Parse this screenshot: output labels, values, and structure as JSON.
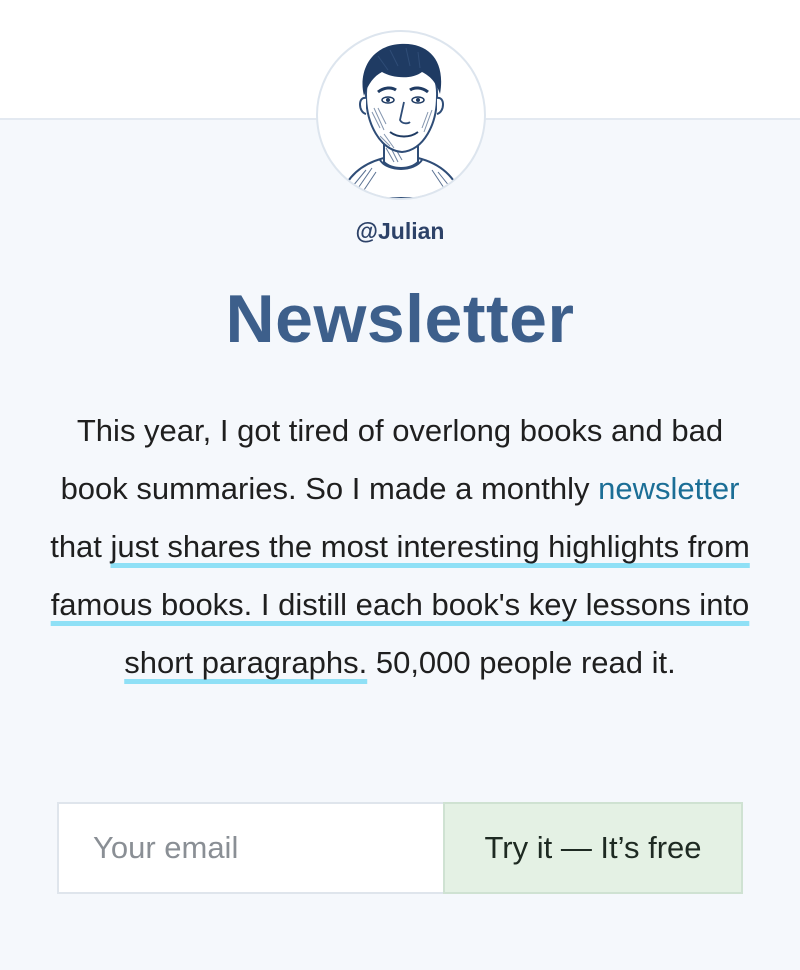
{
  "profile": {
    "username": "@Julian"
  },
  "header": {
    "title": "Newsletter"
  },
  "intro": {
    "part1": "This year, I got tired of overlong books and bad book summaries. So I made a monthly ",
    "link": "newsletter",
    "part2": " that ",
    "highlight": "just shares the most interesting highlights from famous books. I distill each book's key lessons into short paragraphs.",
    "part3": " 50,000 people read it."
  },
  "signup": {
    "placeholder": "Your email",
    "button_label": "Try it — It’s free"
  },
  "colors": {
    "title": "#3d5f8b",
    "link": "#1b6e96",
    "highlight": "#8fe0f6",
    "button_bg": "#e4f1e4",
    "panel_bg": "#f5f8fc"
  }
}
